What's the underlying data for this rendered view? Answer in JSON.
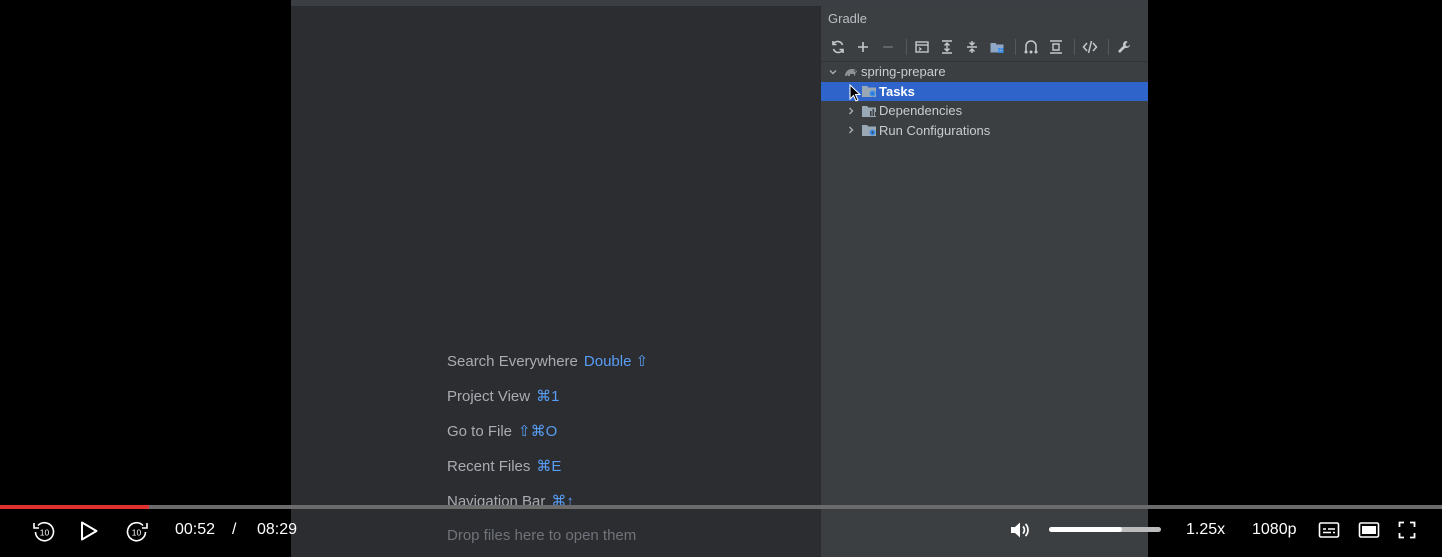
{
  "gradle_panel": {
    "title": "Gradle",
    "toolbar": [
      "refresh-icon",
      "plus-icon",
      "minus-icon",
      "run-window-icon",
      "expand-all-icon",
      "collapse-all-icon",
      "group-modules-icon",
      "dependency-analyzer-icon",
      "toggle-offline-icon",
      "script-icon",
      "settings-wrench-icon"
    ],
    "tree": {
      "root": "spring-prepare",
      "items": [
        {
          "label": "Tasks",
          "selected": true
        },
        {
          "label": "Dependencies",
          "selected": false
        },
        {
          "label": "Run Configurations",
          "selected": false
        }
      ]
    }
  },
  "editor_hints": [
    {
      "label": "Search Everywhere",
      "key": "Double ⇧"
    },
    {
      "label": "Project View",
      "key": "⌘1"
    },
    {
      "label": "Go to File",
      "key": "⇧⌘O"
    },
    {
      "label": "Recent Files",
      "key": "⌘E"
    },
    {
      "label": "Navigation Bar",
      "key": "⌘↑"
    }
  ],
  "drop_hint": "Drop files here to open them",
  "player": {
    "current_time": "00:52",
    "separator": "/",
    "duration": "08:29",
    "progress": 0.103,
    "volume": 0.65,
    "speed": "1.25x",
    "quality": "1080p",
    "skip_seconds": "10",
    "colors": {
      "progress": "#e03131",
      "selection": "#2f65ca",
      "shortcut": "#589df6"
    }
  }
}
